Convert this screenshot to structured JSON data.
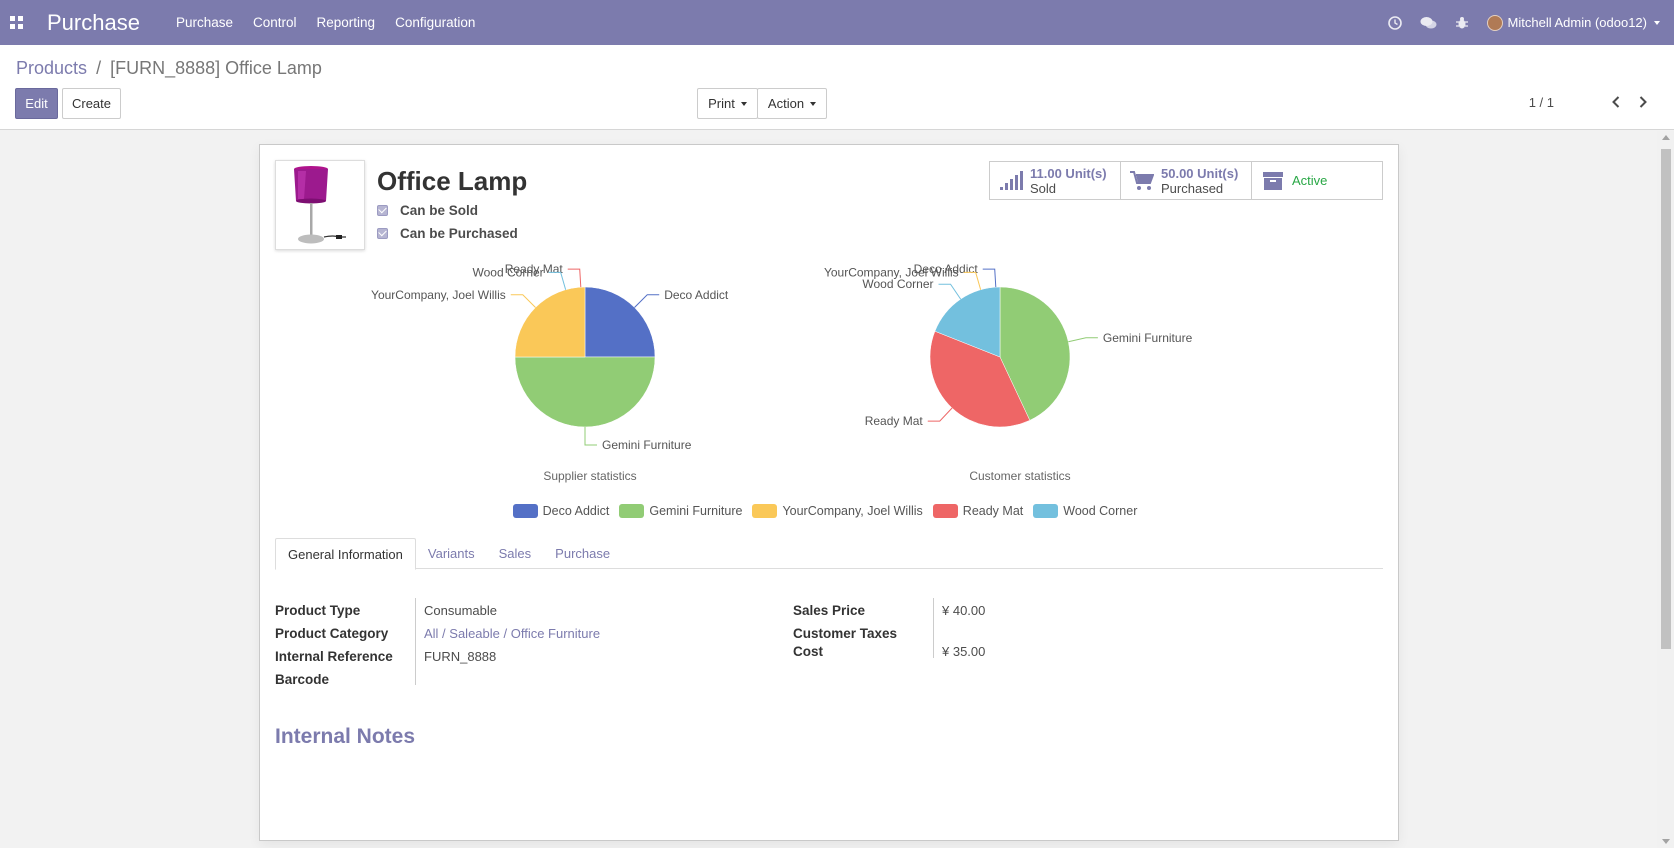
{
  "navbar": {
    "app_title": "Purchase",
    "menu": [
      "Purchase",
      "Control",
      "Reporting",
      "Configuration"
    ],
    "user": "Mitchell Admin (odoo12)"
  },
  "breadcrumb": {
    "parent": "Products",
    "separator": "/",
    "current": "[FURN_8888] Office Lamp"
  },
  "toolbar": {
    "edit": "Edit",
    "create": "Create",
    "print": "Print",
    "action": "Action"
  },
  "pager": {
    "value": "1 / 1"
  },
  "product": {
    "name": "Office Lamp",
    "can_be_sold": "Can be Sold",
    "can_be_purchased": "Can be Purchased"
  },
  "stats": {
    "sold_value": "11.00 Unit(s)",
    "sold_label": "Sold",
    "purchased_value": "50.00 Unit(s)",
    "purchased_label": "Purchased",
    "active_label": "Active"
  },
  "colors": {
    "brand": "#7c7bad",
    "deco_addict": "#5470c6",
    "gemini": "#91cc75",
    "yourcompany": "#fac858",
    "ready_mat": "#ee6666",
    "wood_corner": "#73c0de"
  },
  "chart_data": [
    {
      "type": "pie",
      "title": "Supplier statistics",
      "categories": [
        "Deco Addict",
        "Gemini Furniture",
        "YourCompany, Joel Willis",
        "Ready Mat",
        "Wood Corner"
      ],
      "values": [
        25,
        50,
        25,
        0,
        0
      ]
    },
    {
      "type": "pie",
      "title": "Customer statistics",
      "categories": [
        "Deco Addict",
        "Gemini Furniture",
        "YourCompany, Joel Willis",
        "Ready Mat",
        "Wood Corner"
      ],
      "values": [
        0,
        43,
        0,
        38,
        19
      ]
    }
  ],
  "legend": [
    "Deco Addict",
    "Gemini Furniture",
    "YourCompany, Joel Willis",
    "Ready Mat",
    "Wood Corner"
  ],
  "tabs": [
    "General Information",
    "Variants",
    "Sales",
    "Purchase"
  ],
  "fields": {
    "product_type_label": "Product Type",
    "product_type": "Consumable",
    "product_category_label": "Product Category",
    "product_category": "All / Saleable / Office Furniture",
    "internal_reference_label": "Internal Reference",
    "internal_reference": "FURN_8888",
    "barcode_label": "Barcode",
    "sales_price_label": "Sales Price",
    "sales_price": "¥ 40.00",
    "customer_taxes_label": "Customer Taxes",
    "cost_label": "Cost",
    "cost": "¥ 35.00"
  },
  "internal_notes_title": "Internal Notes"
}
